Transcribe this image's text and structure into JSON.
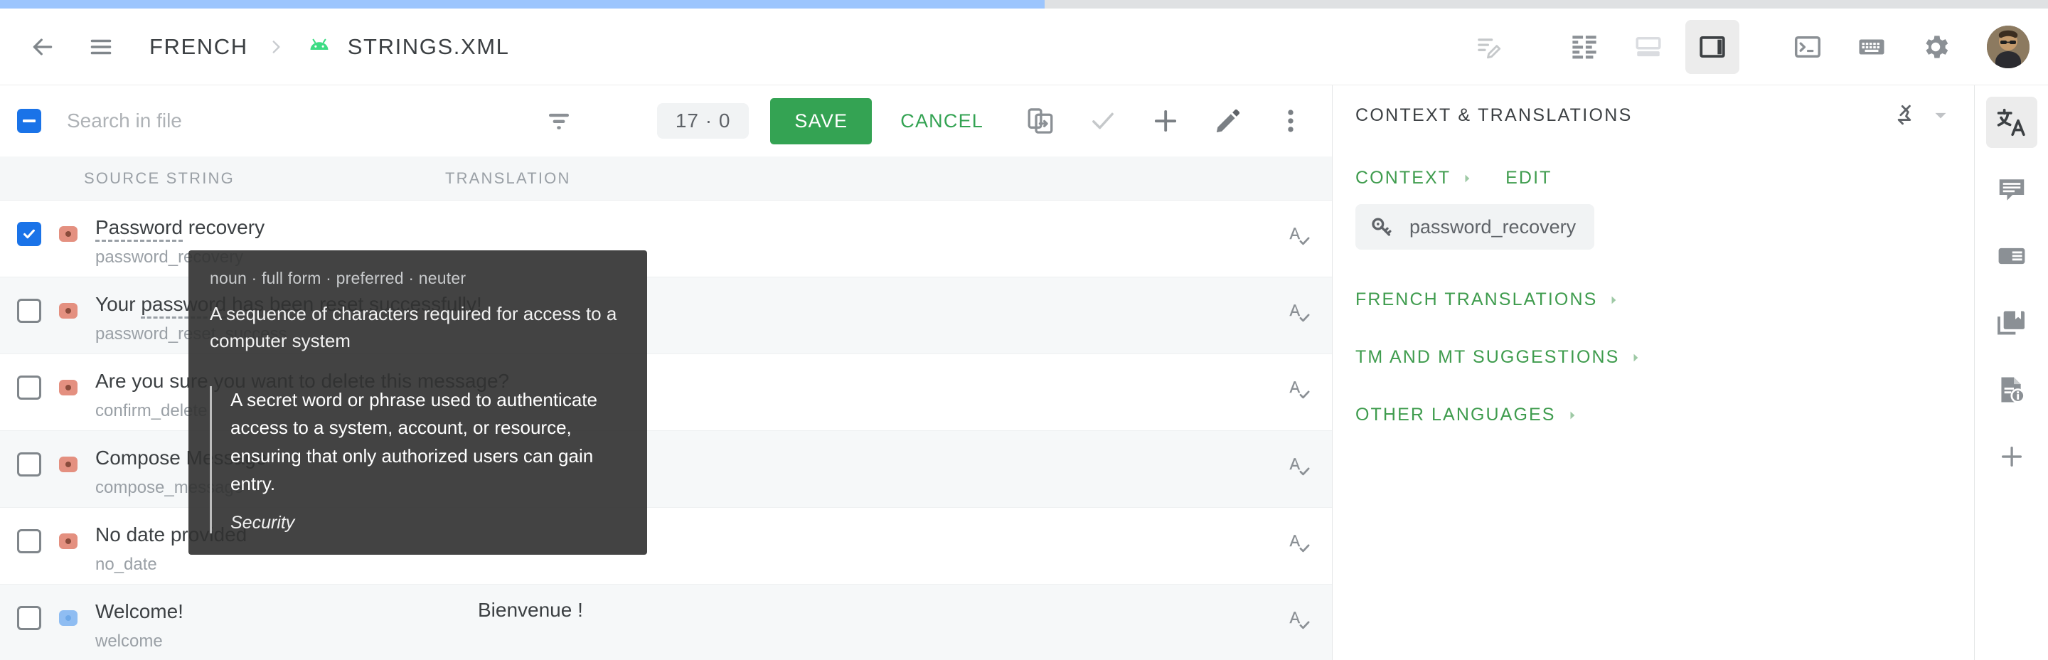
{
  "progress": {
    "percent": 51
  },
  "header": {
    "back_icon": "arrow-left-icon",
    "menu_icon": "hamburger-menu-icon",
    "breadcrumb_language": "FRENCH",
    "breadcrumb_separator": "›",
    "platform_icon": "android-icon",
    "breadcrumb_file": "STRINGS.XML",
    "actions": [
      {
        "name": "edit-notes-icon",
        "label": "Edit notes"
      },
      {
        "name": "split-columns-icon",
        "label": "Column layout"
      },
      {
        "name": "horizontal-layout-icon",
        "label": "Horizontal layout"
      },
      {
        "name": "vertical-layout-icon",
        "label": "Vertical layout",
        "active": true
      },
      {
        "name": "terminal-icon",
        "label": "Console"
      },
      {
        "name": "keyboard-icon",
        "label": "Keyboard shortcuts"
      },
      {
        "name": "gear-icon",
        "label": "Settings"
      }
    ],
    "avatar": "user-avatar"
  },
  "toolbar": {
    "select_all_state": "indeterminate",
    "search_placeholder": "Search in file",
    "search_value": "",
    "filter_icon": "filter-icon",
    "count_badge": "17 · 0",
    "save_label": "SAVE",
    "cancel_label": "CANCEL",
    "actions": [
      {
        "name": "copy-to-device-icon",
        "label": "Copy source"
      },
      {
        "name": "check-icon",
        "label": "Mark reviewed"
      },
      {
        "name": "plus-icon",
        "label": "Add string"
      },
      {
        "name": "pencil-icon",
        "label": "Edit"
      },
      {
        "name": "more-vert-icon",
        "label": "More options"
      }
    ]
  },
  "table": {
    "columns": [
      "SOURCE STRING",
      "TRANSLATION"
    ],
    "rows": [
      {
        "checked": true,
        "status_color": "#e49080",
        "source": "Password recovery",
        "source_term": "Password",
        "source_rest": " recovery",
        "key": "password_recovery",
        "translation": "",
        "spell_icon": "spellcheck-icon",
        "stripe": "white"
      },
      {
        "checked": false,
        "status_color": "#e49080",
        "source": "Your password has been reset successfully!",
        "source_term": "password",
        "source_pre": "Your ",
        "source_rest": " has been reset successfully!",
        "key": "password_reset_success",
        "translation": "",
        "spell_icon": "spellcheck-icon",
        "stripe": "alt"
      },
      {
        "checked": false,
        "status_color": "#e49080",
        "source": "Are you sure you want to delete this message?",
        "key": "confirm_delete",
        "translation": "",
        "spell_icon": "spellcheck-icon",
        "stripe": "white"
      },
      {
        "checked": false,
        "status_color": "#e49080",
        "source": "Compose Message",
        "key": "compose_message",
        "translation": "",
        "spell_icon": "spellcheck-icon",
        "stripe": "alt"
      },
      {
        "checked": false,
        "status_color": "#e49080",
        "source": "No date provided",
        "key": "no_date",
        "translation": "",
        "spell_icon": "spellcheck-icon",
        "stripe": "white"
      },
      {
        "checked": false,
        "status_color": "#8fbdf2",
        "source": "Welcome!",
        "key": "welcome",
        "translation": "Bienvenue !",
        "spell_icon": "spellcheck-icon",
        "stripe": "alt"
      }
    ]
  },
  "tooltip": {
    "meta": "noun · full form · preferred · neuter",
    "definition": "A sequence of characters required for access to a computer system",
    "quote": "A secret word or phrase used to authenticate access to a system, account, or resource, ensuring that only authorized users can gain entry.",
    "quote_source": "Security"
  },
  "right_panel": {
    "title": "CONTEXT & TRANSLATIONS",
    "pin_icon": "pin-off-icon",
    "collapse_icon": "chevron-down-icon",
    "context_label": "CONTEXT",
    "edit_label": "EDIT",
    "context_chip_icon": "key-icon",
    "context_chip_label": "password_recovery",
    "sections": [
      {
        "label": "FRENCH TRANSLATIONS"
      },
      {
        "label": "TM AND MT SUGGESTIONS"
      },
      {
        "label": "OTHER LANGUAGES"
      }
    ]
  },
  "right_rail": {
    "items": [
      {
        "name": "translate-icon",
        "label": "Translations",
        "active": true
      },
      {
        "name": "comment-icon",
        "label": "Comments",
        "active": false
      },
      {
        "name": "screenshot-icon",
        "label": "Screenshots",
        "active": false
      },
      {
        "name": "glossary-icon",
        "label": "Glossary",
        "active": false
      },
      {
        "name": "file-info-icon",
        "label": "File info",
        "active": false
      },
      {
        "name": "plus-icon",
        "label": "Add panel",
        "active": false
      }
    ]
  },
  "colors": {
    "accent_blue": "#1a73e8",
    "accent_green": "#34a353",
    "panel_green": "#3f9c4e",
    "progress_blue": "#9cc5fd",
    "status_red": "#e49080",
    "status_blue": "#8fbdf2"
  }
}
